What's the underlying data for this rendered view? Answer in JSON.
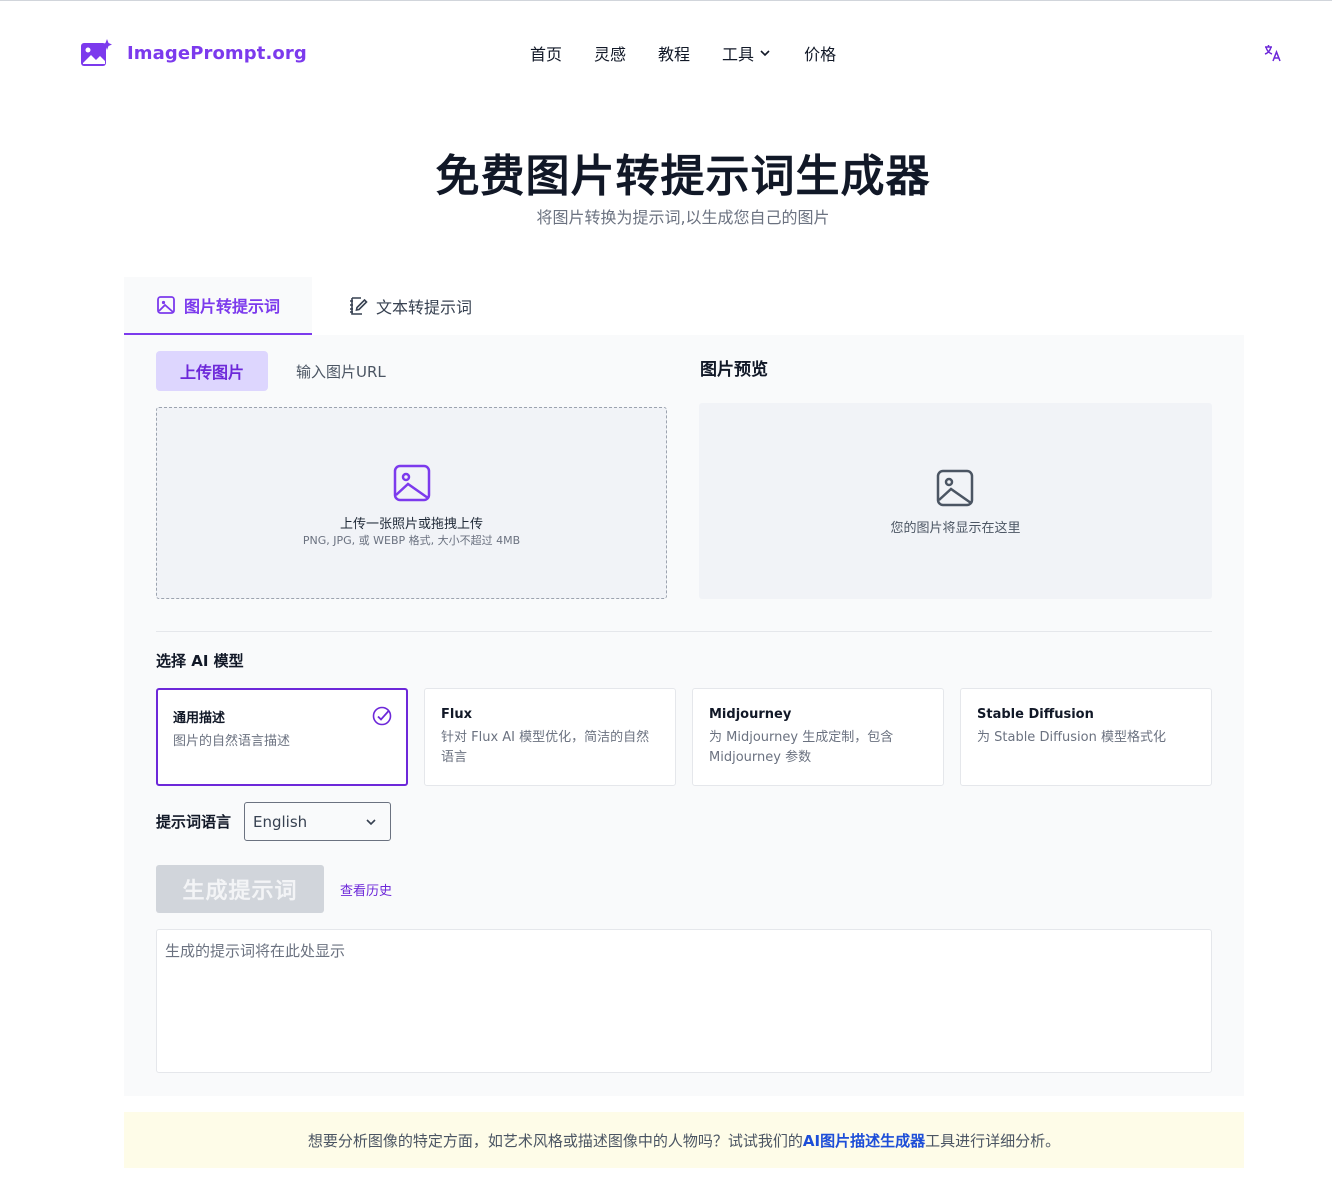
{
  "header": {
    "logo_text": "ImagePrompt.org",
    "nav": [
      {
        "label": "首页"
      },
      {
        "label": "灵感"
      },
      {
        "label": "教程"
      },
      {
        "label": "工具",
        "has_dropdown": true
      },
      {
        "label": "价格"
      }
    ],
    "language_icon": "translate-icon"
  },
  "hero": {
    "title": "免费图片转提示词生成器",
    "subtitle": "将图片转换为提示词,以生成您自己的图片"
  },
  "main_tabs": [
    {
      "label": "图片转提示词",
      "icon": "image-icon",
      "active": true
    },
    {
      "label": "文本转提示词",
      "icon": "notebook-pen-icon",
      "active": false
    }
  ],
  "upload": {
    "tab_upload": "上传图片",
    "tab_url": "输入图片URL",
    "dropzone_main": "上传一张照片或拖拽上传",
    "dropzone_sub": "PNG, JPG, 或 WEBP 格式, 大小不超过 4MB"
  },
  "preview": {
    "title": "图片预览",
    "placeholder": "您的图片将显示在这里"
  },
  "models": {
    "label": "选择 AI 模型",
    "items": [
      {
        "name": "通用描述",
        "desc": "图片的自然语言描述",
        "selected": true
      },
      {
        "name": "Flux",
        "desc": "针对 Flux AI 模型优化，简洁的自然语言",
        "selected": false
      },
      {
        "name": "Midjourney",
        "desc": "为 Midjourney 生成定制，包含 Midjourney 参数",
        "selected": false
      },
      {
        "name": "Stable Diffusion",
        "desc": "为 Stable Diffusion 模型格式化",
        "selected": false
      }
    ]
  },
  "language": {
    "label": "提示词语言",
    "selected": "English"
  },
  "actions": {
    "generate": "生成提示词",
    "history": "查看历史"
  },
  "output": {
    "placeholder": "生成的提示词将在此处显示"
  },
  "banner": {
    "before": "想要分析图像的特定方面，如艺术风格或描述图像中的人物吗？试试我们的",
    "link": "AI图片描述生成器",
    "after": "工具进行详细分析。"
  },
  "colors": {
    "accent": "#7c3aed",
    "accent_light": "#ddd6fe",
    "banner_bg": "#fefce8",
    "link_blue": "#1d4ed8"
  }
}
